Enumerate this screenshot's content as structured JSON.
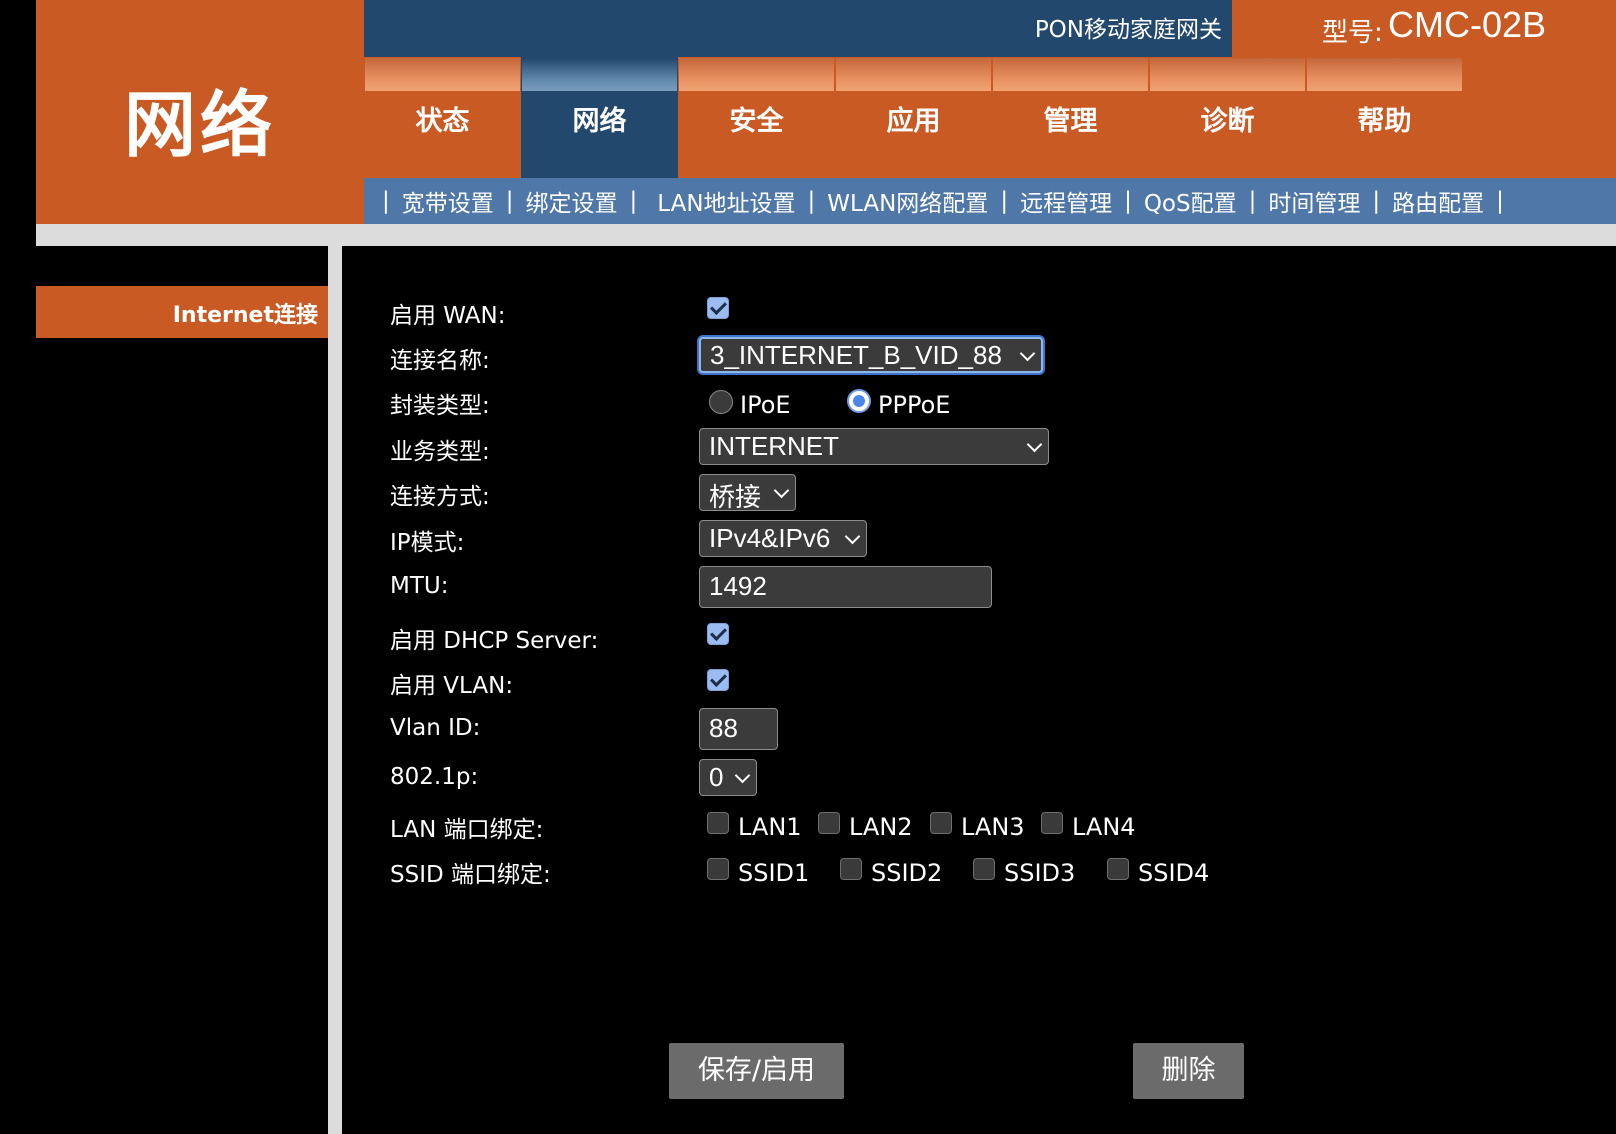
{
  "header": {
    "page_heading": "网络",
    "product_name": "PON移动家庭网关",
    "model_label": "型号:",
    "model_value": "CMC-02B"
  },
  "tabs": [
    {
      "label": "状态",
      "active": false
    },
    {
      "label": "网络",
      "active": true
    },
    {
      "label": "安全",
      "active": false
    },
    {
      "label": "应用",
      "active": false
    },
    {
      "label": "管理",
      "active": false
    },
    {
      "label": "诊断",
      "active": false
    },
    {
      "label": "帮助",
      "active": false
    }
  ],
  "subnav": {
    "separator": "|",
    "items": [
      "宽带设置",
      "绑定设置",
      "LAN地址设置",
      "WLAN网络配置",
      "远程管理",
      "QoS配置",
      "时间管理",
      "路由配置"
    ]
  },
  "sidebar": {
    "items": [
      {
        "label": "Internet连接",
        "active": true
      }
    ]
  },
  "form": {
    "enable_wan": {
      "label": "启用 WAN:",
      "checked": true
    },
    "connection_name": {
      "label": "连接名称:",
      "value": "3_INTERNET_B_VID_88"
    },
    "encapsulation": {
      "label": "封装类型:",
      "options": [
        "IPoE",
        "PPPoE"
      ],
      "selected": "PPPoE"
    },
    "service_type": {
      "label": "业务类型:",
      "value": "INTERNET"
    },
    "connection_mode": {
      "label": "连接方式:",
      "value": "桥接"
    },
    "ip_mode": {
      "label": "IP模式:",
      "value": "IPv4&IPv6"
    },
    "mtu": {
      "label": "MTU:",
      "value": "1492"
    },
    "enable_dhcp": {
      "label": "启用 DHCP Server:",
      "checked": true
    },
    "enable_vlan": {
      "label": "启用 VLAN:",
      "checked": true
    },
    "vlan_id": {
      "label": "Vlan ID:",
      "value": "88"
    },
    "dot1p": {
      "label": "802.1p:",
      "value": "0"
    },
    "lan_binding": {
      "label": "LAN 端口绑定:",
      "ports": [
        "LAN1",
        "LAN2",
        "LAN3",
        "LAN4"
      ]
    },
    "ssid_binding": {
      "label": "SSID 端口绑定:",
      "ports": [
        "SSID1",
        "SSID2",
        "SSID3",
        "SSID4"
      ]
    }
  },
  "buttons": {
    "save": "保存/启用",
    "delete": "删除"
  },
  "colors": {
    "orange": "#c95a23",
    "navy": "#23486d",
    "subnav_blue": "#4f78a9"
  }
}
